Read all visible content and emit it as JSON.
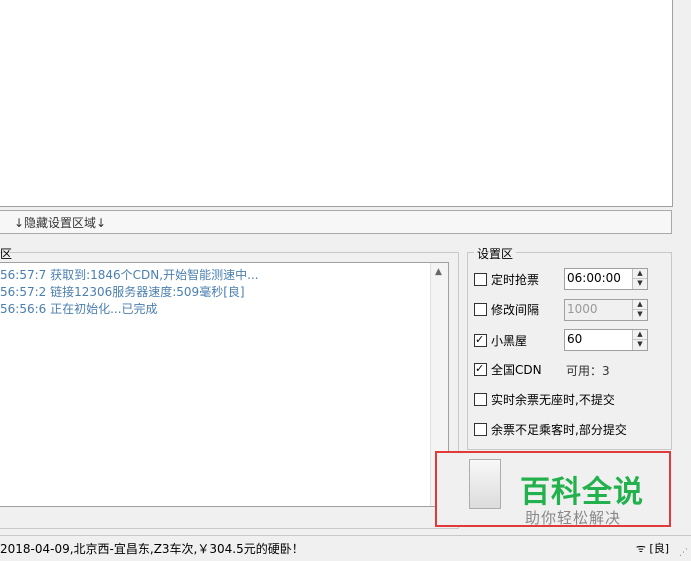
{
  "hidden_settings_label": "↓隐藏设置区域↓",
  "log": {
    "title": "区",
    "lines": [
      "56:57:7  获取到:1846个CDN,开始智能测速中...",
      "56:57:2  链接12306服务器速度:509毫秒[良]",
      "56:56:6  正在初始化...已完成"
    ]
  },
  "settings": {
    "title": "设置区",
    "timed_grab": {
      "label": "定时抢票",
      "checked": false,
      "value": "06:00:00"
    },
    "interval": {
      "label": "修改间隔",
      "checked": false,
      "value": "1000"
    },
    "blacklist": {
      "label": "小黑屋",
      "checked": true,
      "value": "60"
    },
    "cdn": {
      "label": "全国CDN",
      "checked": true,
      "available": "可用：3"
    },
    "no_seat": {
      "label": "实时余票无座时,不提交",
      "checked": false
    },
    "partial": {
      "label": "余票不足乘客时,部分提交",
      "checked": false
    }
  },
  "watermark": {
    "title": "百科全说",
    "subtitle": "助你轻松解决"
  },
  "status_bar": {
    "message": "2018-04-09,北京西-宜昌东,Z3车次,￥304.5元的硬卧！",
    "network": "[良]",
    "wifi_icon": "wifi-icon"
  },
  "colors": {
    "log_text": "#4a7fb0",
    "watermark_green": "#22b14c",
    "highlight_border": "#e03a3a"
  }
}
